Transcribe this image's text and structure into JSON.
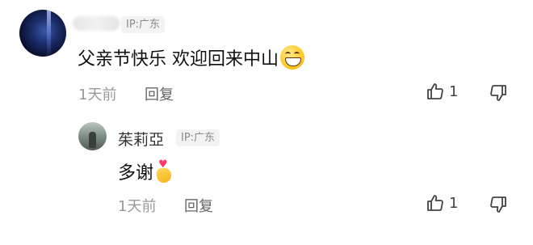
{
  "comment": {
    "ip": "IP:广东",
    "text": "父亲节快乐 欢迎回来中山",
    "emoji": "grinning-face",
    "time": "1天前",
    "reply_label": "回复",
    "like_count": "1"
  },
  "reply": {
    "username": "茱莉亞",
    "ip": "IP:广东",
    "text": "多谢",
    "emoji": "finger-heart",
    "time": "1天前",
    "reply_label": "回复",
    "like_count": "1"
  }
}
